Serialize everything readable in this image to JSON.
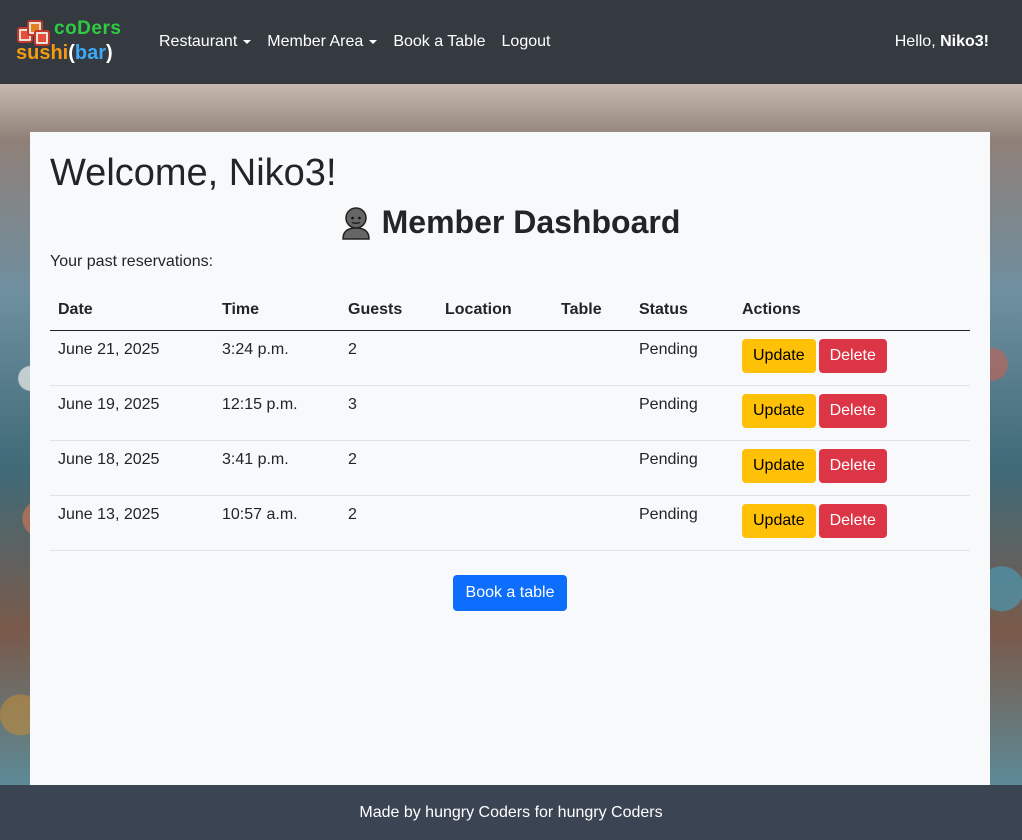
{
  "brand": {
    "line1": "coDers",
    "line2_a": "sushi",
    "line2_open": "(",
    "line2_b": "bar",
    "line2_close": ")"
  },
  "nav": {
    "restaurant": "Restaurant",
    "member_area": "Member Area",
    "book": "Book a Table",
    "logout": "Logout",
    "hello_prefix": "Hello,",
    "username": "Niko3!"
  },
  "main": {
    "welcome": "Welcome, Niko3!",
    "dashboard_title": "Member Dashboard",
    "past_label": "Your past reservations:",
    "book_button": "Book a table"
  },
  "table": {
    "headers": [
      "Date",
      "Time",
      "Guests",
      "Location",
      "Table",
      "Status",
      "Actions"
    ],
    "rows": [
      {
        "date": "June 21, 2025",
        "time": "3:24 p.m.",
        "guests": "2",
        "location": "",
        "table": "",
        "status": "Pending"
      },
      {
        "date": "June 19, 2025",
        "time": "12:15 p.m.",
        "guests": "3",
        "location": "",
        "table": "",
        "status": "Pending"
      },
      {
        "date": "June 18, 2025",
        "time": "3:41 p.m.",
        "guests": "2",
        "location": "",
        "table": "",
        "status": "Pending"
      },
      {
        "date": "June 13, 2025",
        "time": "10:57 a.m.",
        "guests": "2",
        "location": "",
        "table": "",
        "status": "Pending"
      }
    ],
    "update_label": "Update",
    "delete_label": "Delete"
  },
  "footer": {
    "text": "Made by hungry Coders for hungry Coders"
  },
  "colors": {
    "navbar": "#343a40",
    "warning": "#ffc107",
    "danger": "#dc3545",
    "primary": "#0d6efd",
    "footer": "#3b4452"
  }
}
